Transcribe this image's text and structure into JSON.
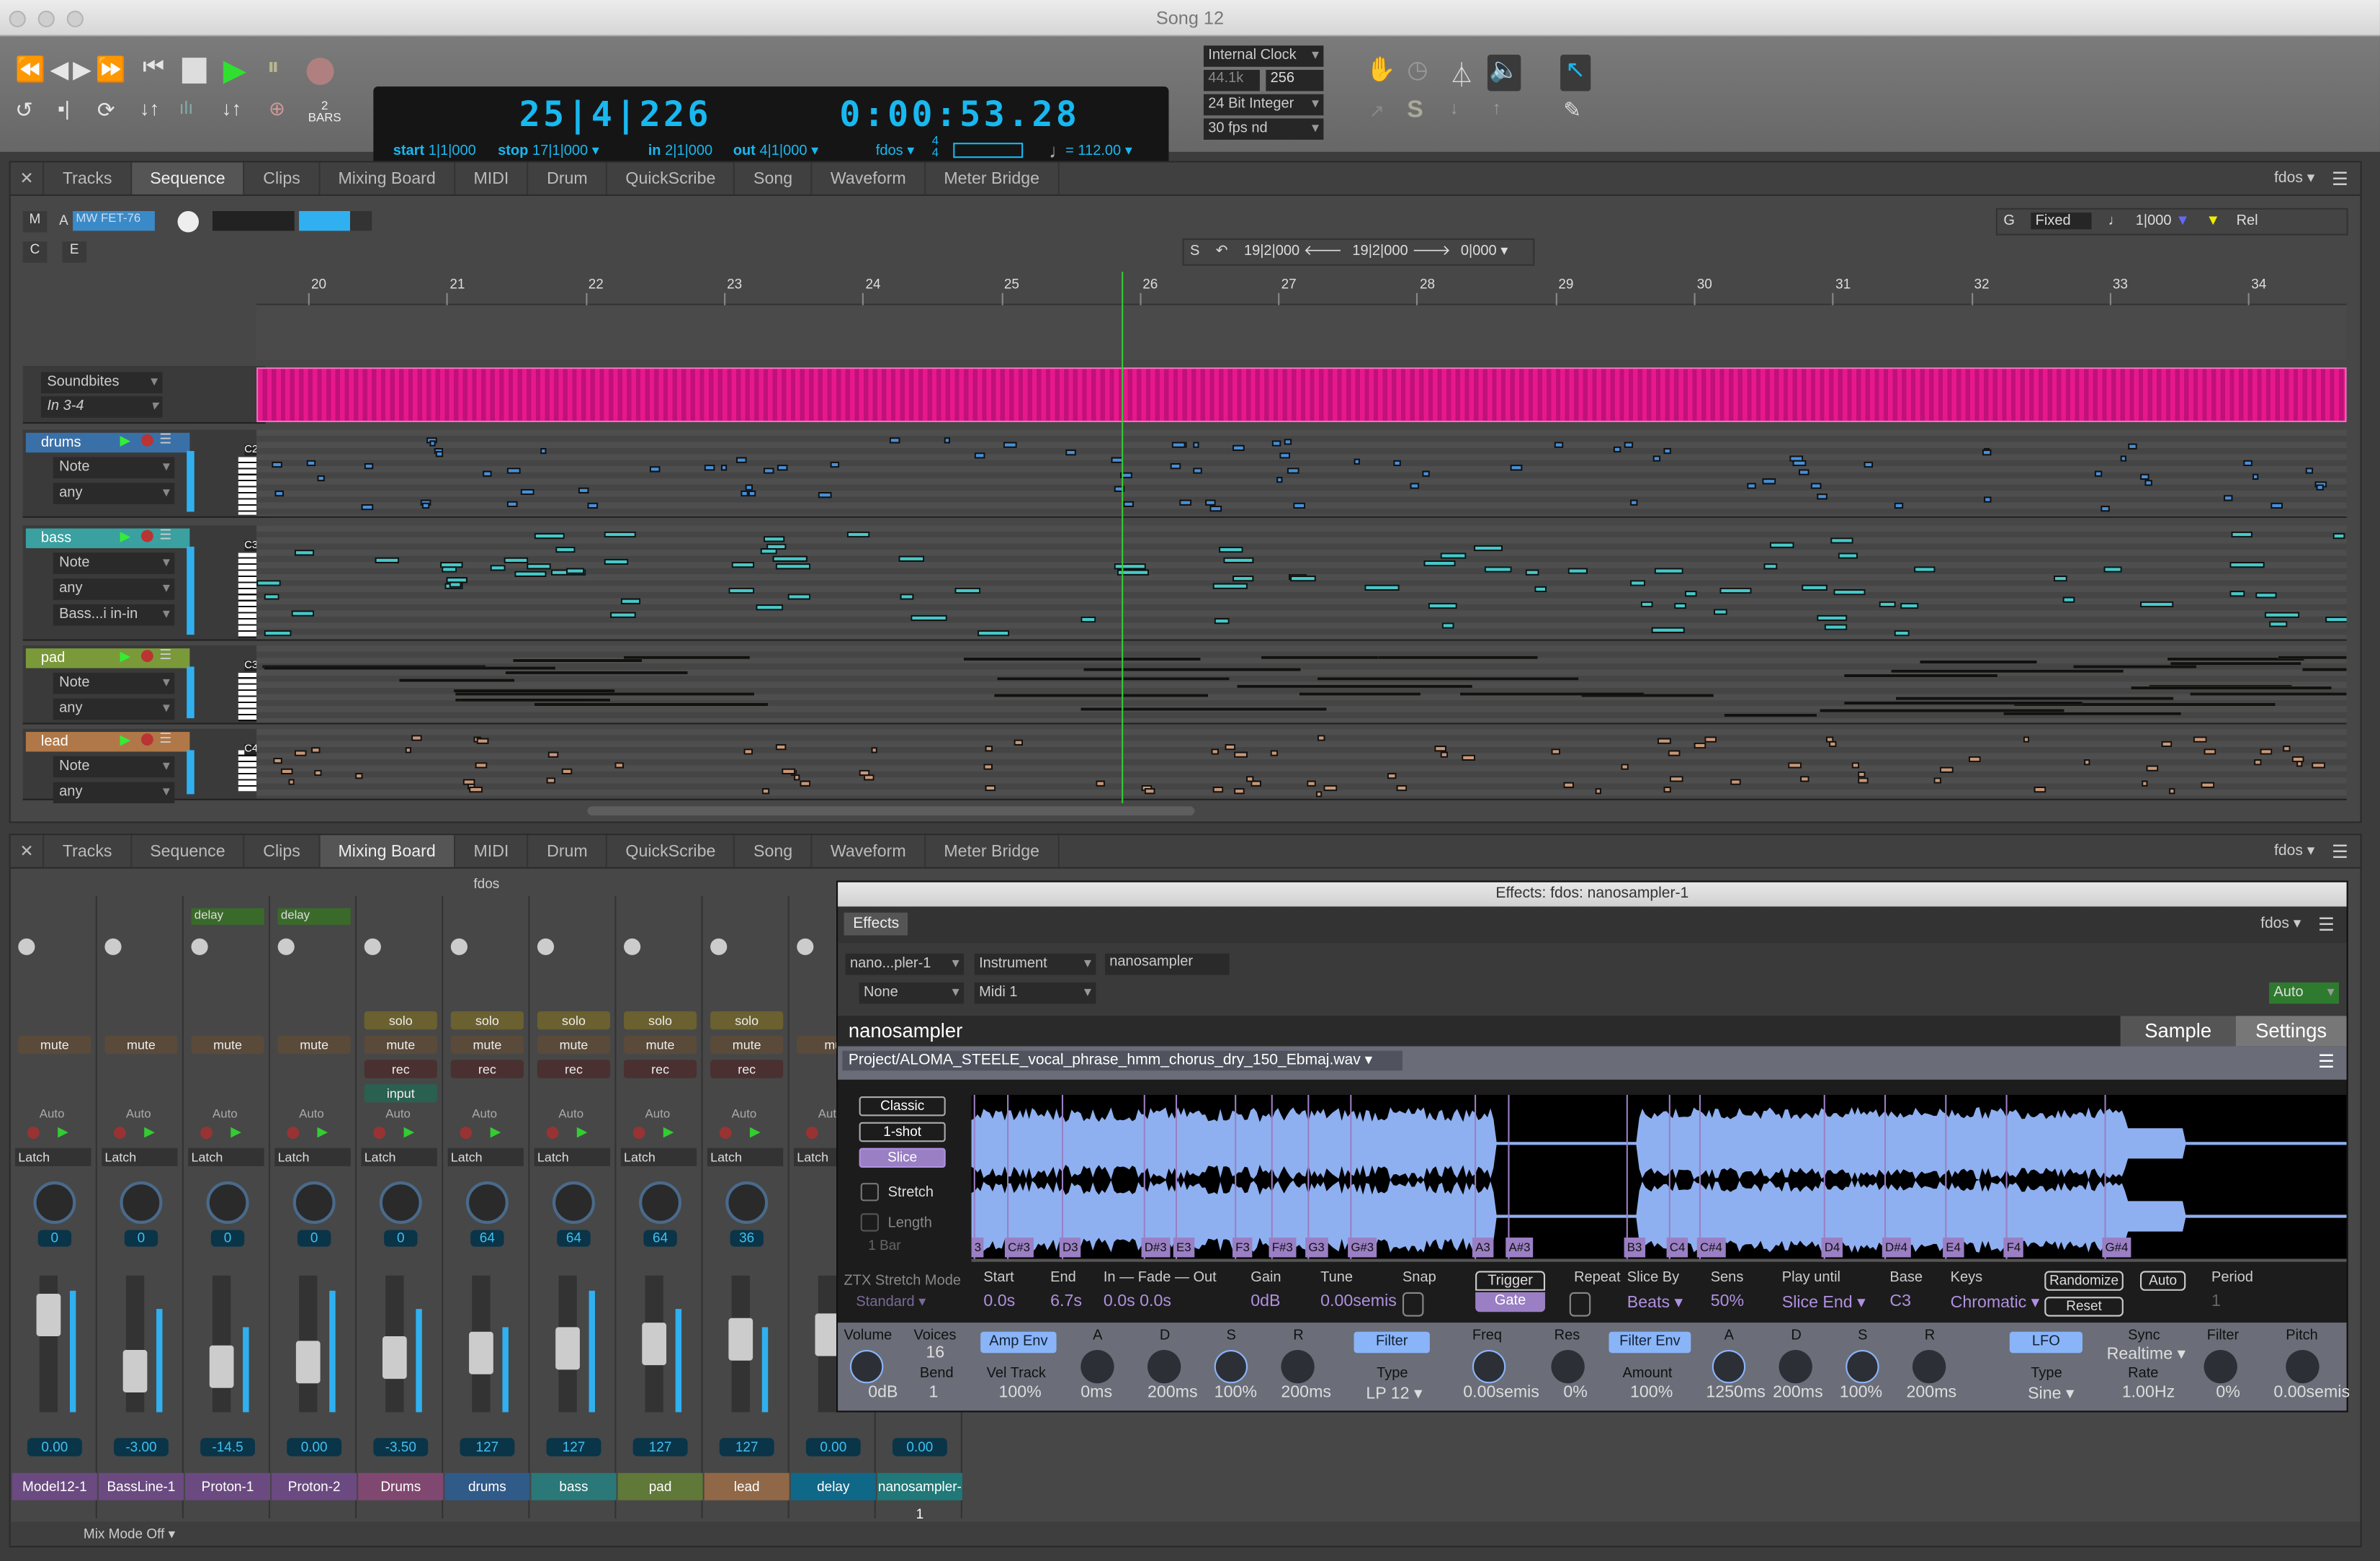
{
  "window": {
    "title": "Song 12"
  },
  "transport": {
    "position_bbt": "25|4|226",
    "position_time": "0:00:53.28",
    "start_label": "start",
    "start": "1|1|000",
    "stop_label": "stop",
    "stop": "17|1|000",
    "in_label": "in",
    "in": "2|1|000",
    "out_label": "out",
    "out": "4|1|000",
    "sync": "fdos",
    "meter_top": "4",
    "meter_bottom": "4",
    "tempo": "= 112.00",
    "bars_count": "2",
    "bars_label": "BARS",
    "clock": "Internal Clock",
    "sample_rate": "44.1k",
    "buffer": "256",
    "bit_depth": "24 Bit Integer",
    "fps": "30 fps nd"
  },
  "top_pane": {
    "tabs": [
      "Tracks",
      "Sequence",
      "Clips",
      "Mixing Board",
      "MIDI",
      "Drum",
      "QuickScribe",
      "Song",
      "Waveform",
      "Meter Bridge"
    ],
    "active_tab": "Sequence",
    "sync": "fdos ▾",
    "plugin_slot": "MW FET-76",
    "m": "M",
    "a": "A",
    "c": "C",
    "e": "E",
    "selection": {
      "s": "S",
      "start": "19|2|000",
      "end": "19|2|000",
      "length": "0|000"
    },
    "grid": {
      "g": "G",
      "mode": "Fixed",
      "value": "1|000",
      "rel": "Rel"
    },
    "bars": [
      "20",
      "21",
      "22",
      "23",
      "24",
      "25",
      "26",
      "27",
      "28",
      "29",
      "30",
      "31",
      "32",
      "33",
      "34"
    ],
    "playhead_bar": 25.85,
    "tracks": [
      {
        "name": "Soundbites",
        "sub": "In 3-4",
        "color": "#e040c0"
      },
      {
        "name": "drums",
        "type": "Note",
        "input": "any",
        "color": "#3a70a8",
        "octave": "C2"
      },
      {
        "name": "bass",
        "type": "Note",
        "input": "any",
        "output": "Bass...i in-in",
        "color": "#3aa0a0",
        "octave": "C3"
      },
      {
        "name": "pad",
        "type": "Note",
        "input": "any",
        "color": "#7a9a3a",
        "octave": "C3"
      },
      {
        "name": "lead",
        "type": "Note",
        "input": "any",
        "color": "#b07848",
        "octave": "C4"
      }
    ]
  },
  "bottom_pane": {
    "tabs": [
      "Tracks",
      "Sequence",
      "Clips",
      "Mixing Board",
      "MIDI",
      "Drum",
      "QuickScribe",
      "Song",
      "Waveform",
      "Meter Bridge"
    ],
    "active_tab": "Mixing Board",
    "sync": "fdos ▾",
    "mixer_label": "fdos",
    "footer": "Mix Mode Off",
    "strips": [
      {
        "name": "Model12-1",
        "color": "#6a4a80",
        "value": "0.00",
        "pan": "0",
        "auto": "Auto",
        "latch": "Latch",
        "buttons": [
          "mute"
        ],
        "send": ""
      },
      {
        "name": "BassLine-1",
        "color": "#6a4a80",
        "value": "-3.00",
        "pan": "0",
        "auto": "Auto",
        "latch": "Latch",
        "buttons": [
          "mute"
        ],
        "send": ""
      },
      {
        "name": "Proton-1",
        "color": "#6a4a80",
        "value": "-14.5",
        "pan": "0",
        "auto": "Auto",
        "latch": "Latch",
        "buttons": [
          "mute"
        ],
        "send": "delay"
      },
      {
        "name": "Proton-2",
        "color": "#6a4a80",
        "value": "0.00",
        "pan": "0",
        "auto": "Auto",
        "latch": "Latch",
        "buttons": [
          "mute"
        ],
        "send": "delay"
      },
      {
        "name": "Drums",
        "color": "#804870",
        "value": "-3.50",
        "pan": "0",
        "auto": "Auto",
        "latch": "Latch",
        "buttons": [
          "solo",
          "mute",
          "rec",
          "input"
        ],
        "send": ""
      },
      {
        "name": "drums",
        "color": "#305a88",
        "value": "127",
        "pan": "64",
        "auto": "Auto",
        "latch": "Latch",
        "buttons": [
          "solo",
          "mute",
          "rec"
        ],
        "send": ""
      },
      {
        "name": "bass",
        "color": "#2a7878",
        "value": "127",
        "pan": "64",
        "auto": "Auto",
        "latch": "Latch",
        "buttons": [
          "solo",
          "mute",
          "rec"
        ],
        "send": ""
      },
      {
        "name": "pad",
        "color": "#607838",
        "value": "127",
        "pan": "64",
        "auto": "Auto",
        "latch": "Latch",
        "buttons": [
          "solo",
          "mute",
          "rec"
        ],
        "send": ""
      },
      {
        "name": "lead",
        "color": "#906848",
        "value": "127",
        "pan": "36",
        "auto": "Auto",
        "latch": "Latch",
        "buttons": [
          "solo",
          "mute",
          "rec"
        ],
        "send": ""
      },
      {
        "name": "delay",
        "color": "#106888",
        "value": "0.00",
        "pan": "",
        "auto": "Aut",
        "latch": "Latch",
        "buttons": [
          "mu"
        ],
        "send": ""
      },
      {
        "name": "nanosampler-1",
        "color": "#207878",
        "value": "0.00",
        "pan": "",
        "auto": "",
        "latch": "",
        "buttons": [],
        "send": ""
      }
    ]
  },
  "effects": {
    "title": "Effects: fdos: nanosampler-1",
    "tab": "Effects",
    "sync": "fdos ▾",
    "insert": "nano...pler-1",
    "kind": "Instrument",
    "plugin": "nanosampler",
    "input": "None",
    "midi": "Midi 1",
    "auto": "Auto",
    "instrument": {
      "name": "nanosampler",
      "tabs": [
        "Sample",
        "Settings"
      ],
      "file": "Project/ALOMA_STEELE_vocal_phrase_hmm_chorus_dry_150_Ebmaj.wav",
      "modes": [
        "Classic",
        "1-shot",
        "Slice"
      ],
      "active_mode": "Slice",
      "stretch": "Stretch",
      "length": "Length",
      "length_value": "1 Bar",
      "slices": [
        "3",
        "C#3",
        "D3",
        "D#3",
        "E3",
        "F3",
        "F#3",
        "G3",
        "G#3",
        "A3",
        "A#3",
        "B3",
        "C4",
        "C#4",
        "D4",
        "D#4",
        "E4",
        "F4",
        "G#4"
      ],
      "stretch_mode_label": "ZTX Stretch Mode",
      "stretch_mode": "Standard",
      "params": [
        {
          "l": "Start",
          "v": "0.0s"
        },
        {
          "l": "End",
          "v": "6.7s"
        },
        {
          "l": "In — Fade — Out",
          "v": "0.0s   0.0s"
        },
        {
          "l": "Gain",
          "v": "0dB"
        },
        {
          "l": "Tune",
          "v": "0.00semis"
        },
        {
          "l": "Snap",
          "v": ""
        },
        {
          "l": "Repeat",
          "v": ""
        },
        {
          "l": "Slice By",
          "v": "Beats ▾"
        },
        {
          "l": "Sens",
          "v": "50%"
        },
        {
          "l": "Play until",
          "v": "Slice End ▾"
        },
        {
          "l": "Base",
          "v": "C3"
        },
        {
          "l": "Keys",
          "v": "Chromatic ▾"
        },
        {
          "l": "Period",
          "v": "1"
        }
      ],
      "trigger": "Trigger",
      "gate": "Gate",
      "randomize": "Randomize",
      "auto": "Auto",
      "reset": "Reset",
      "bottom": {
        "volume_label": "Volume",
        "volume": "0dB",
        "voices_label": "Voices",
        "voices": "16",
        "bend_label": "Bend",
        "bend": "1",
        "amp_env": "Amp Env",
        "vel_track_label": "Vel Track",
        "vel_track": "100%",
        "amp": [
          {
            "l": "A",
            "v": "0ms"
          },
          {
            "l": "D",
            "v": "200ms"
          },
          {
            "l": "S",
            "v": "100%"
          },
          {
            "l": "R",
            "v": "200ms"
          }
        ],
        "filter": "Filter",
        "type_label": "Type",
        "filter_type": "LP 12 ▾",
        "freq_label": "Freq",
        "freq": "0.00semis",
        "res_label": "Res",
        "res": "0%",
        "filter_env": "Filter Env",
        "amount_label": "Amount",
        "amount": "100%",
        "fenv": [
          {
            "l": "A",
            "v": "1250ms"
          },
          {
            "l": "D",
            "v": "200ms"
          },
          {
            "l": "S",
            "v": "100%"
          },
          {
            "l": "R",
            "v": "200ms"
          }
        ],
        "lfo": "LFO",
        "lfo_type": "Sine ▾",
        "sync_label": "Sync",
        "sync": "Realtime ▾",
        "rate_label": "Rate",
        "rate": "1.00Hz",
        "lfo_filter_label": "Filter",
        "lfo_filter": "0%",
        "pitch_label": "Pitch",
        "pitch": "0.00semis"
      }
    }
  }
}
